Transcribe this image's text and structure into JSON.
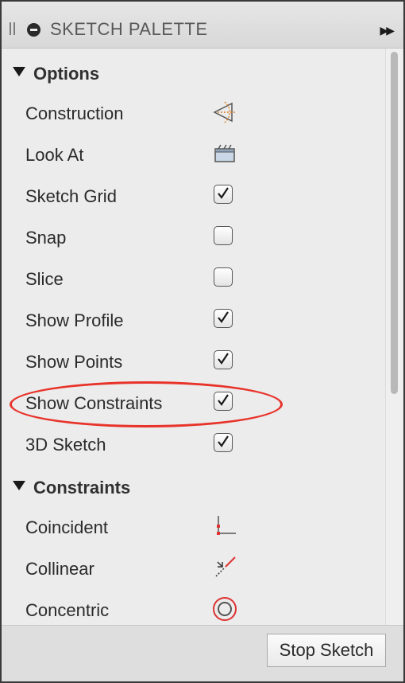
{
  "title": "SKETCH PALETTE",
  "sections": {
    "options": {
      "label": "Options",
      "items": [
        {
          "label": "Construction",
          "icon": "construction-icon"
        },
        {
          "label": "Look At",
          "icon": "look-at-icon"
        },
        {
          "label": "Sketch Grid",
          "checked": true
        },
        {
          "label": "Snap",
          "checked": false
        },
        {
          "label": "Slice",
          "checked": false
        },
        {
          "label": "Show Profile",
          "checked": true
        },
        {
          "label": "Show Points",
          "checked": true
        },
        {
          "label": "Show Constraints",
          "checked": true
        },
        {
          "label": "3D Sketch",
          "checked": true
        }
      ]
    },
    "constraints": {
      "label": "Constraints",
      "items": [
        {
          "label": "Coincident",
          "icon": "coincident-icon"
        },
        {
          "label": "Collinear",
          "icon": "collinear-icon"
        },
        {
          "label": "Concentric",
          "icon": "concentric-icon"
        }
      ]
    }
  },
  "footer": {
    "stop_label": "Stop Sketch"
  },
  "annotation": {
    "color": "#e8332a"
  }
}
